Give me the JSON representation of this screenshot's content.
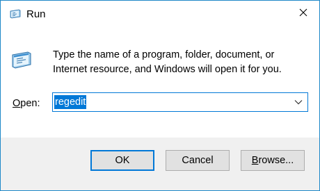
{
  "window": {
    "title": "Run",
    "title_icon": "run-app-icon",
    "close_icon": "close-icon",
    "accent_color": "#0078d7",
    "border_color": "#1e88c8"
  },
  "body": {
    "description": "Type the name of a program, folder, document, or Internet resource, and Windows will open it for you.",
    "icon": "run-app-icon"
  },
  "open_field": {
    "label_prefix": "",
    "label_accel": "O",
    "label_rest": "pen:",
    "value": "regedit",
    "dropdown_icon": "chevron-down-icon"
  },
  "buttons": {
    "ok": "OK",
    "cancel": "Cancel",
    "browse_prefix": "",
    "browse_accel": "B",
    "browse_rest": "rowse..."
  },
  "footer_color": "#f0f0f0"
}
